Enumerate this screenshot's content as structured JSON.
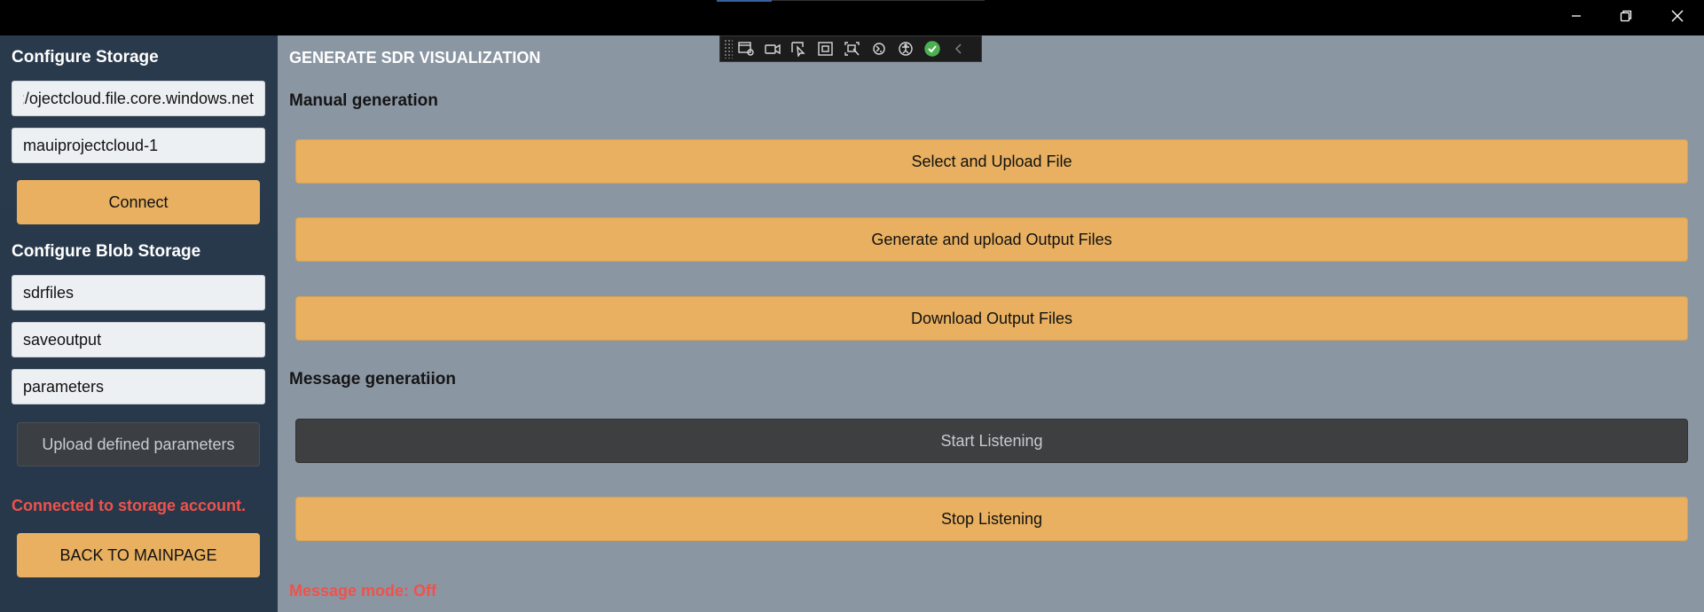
{
  "window": {
    "minimize_icon": "minimize-icon",
    "maximize_icon": "restore-icon",
    "close_icon": "close-icon"
  },
  "toolbar": {
    "icons": [
      "live-visual-tree-icon",
      "record-icon",
      "select-element-icon",
      "display-layout-adorners-icon",
      "track-focus-icon",
      "hot-reload-icon",
      "accessibility-icon",
      "check-icon",
      "collapse-chevron-icon"
    ]
  },
  "sidebar": {
    "configure_storage_title": "Configure Storage",
    "connection_string": "ojectcloud.file.core.windows.net/;",
    "share_name": "mauiprojectcloud-1",
    "connect_label": "Connect",
    "configure_blob_title": "Configure Blob Storage",
    "blob_container_1": "sdrfiles",
    "blob_container_2": "saveoutput",
    "blob_container_3": "parameters",
    "upload_params_label": "Upload defined parameters",
    "status_text": "Connected to storage account.",
    "back_label": "BACK TO MAINPAGE"
  },
  "main": {
    "title": "GENERATE SDR VISUALIZATION",
    "manual_section": "Manual generation",
    "select_upload_label": "Select and Upload File",
    "generate_upload_label": "Generate and upload Output Files",
    "download_label": "Download Output Files",
    "message_section": "Message generatiion",
    "start_listening_label": "Start Listening",
    "stop_listening_label": "Stop Listening",
    "message_mode_text": "Message mode: Off"
  },
  "colors": {
    "accent_orange": "#e8b060",
    "status_red": "#f0524b",
    "sidebar_bg": "#2a3a4d",
    "main_bg": "#8b96a3"
  }
}
